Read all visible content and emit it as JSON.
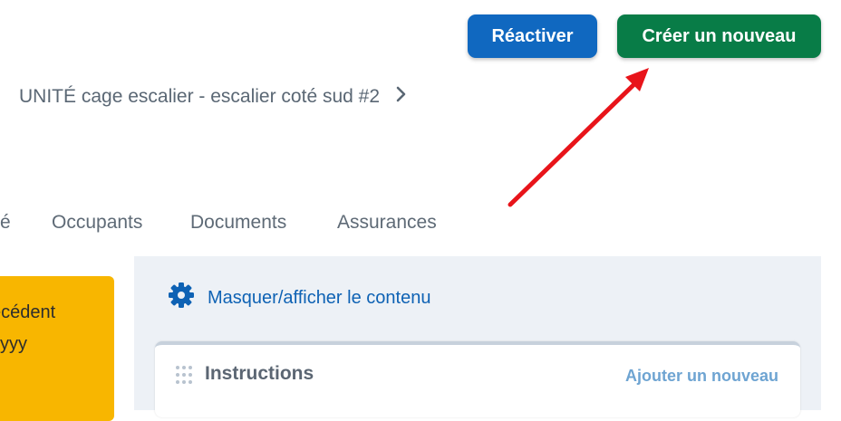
{
  "header": {
    "reactivate_label": "Réactiver",
    "create_label": "Créer un nouveau"
  },
  "breadcrumb": {
    "label": "UNITÉ cage escalier - escalier coté sud #2",
    "chevron": "›"
  },
  "tabs": [
    {
      "label": "é"
    },
    {
      "label": "Occupants"
    },
    {
      "label": "Documents"
    },
    {
      "label": "Assurances"
    }
  ],
  "notice": {
    "line1": "écédent",
    "line2": "yyyy"
  },
  "panel": {
    "toggle_label": "Masquer/afficher le contenu",
    "toggle_icon": "gear-icon"
  },
  "section": {
    "title": "Instructions",
    "add_label": "Ajouter un nouveau",
    "drag_icon": "drag-handle-icon"
  },
  "colors": {
    "reactivate_button": "#1068c0",
    "create_button": "#087c47",
    "notice_background": "#f8b600",
    "panel_background": "#edf1f6",
    "link": "#0e62b4",
    "annotation_arrow": "#e8141a"
  }
}
